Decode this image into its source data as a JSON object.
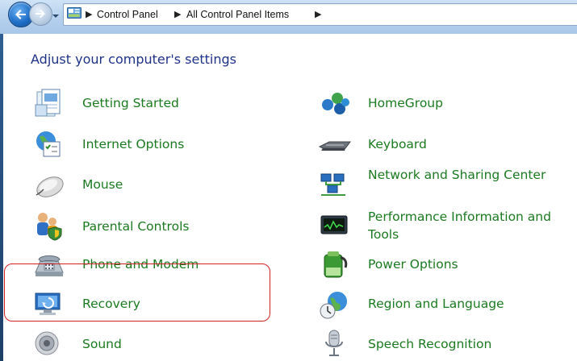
{
  "breadcrumbs": [
    "Control Panel",
    "All Control Panel Items"
  ],
  "heading": "Adjust your computer's settings",
  "items_left": [
    {
      "label": "Getting Started",
      "icon": "getting-started-icon"
    },
    {
      "label": "Internet Options",
      "icon": "internet-options-icon"
    },
    {
      "label": "Mouse",
      "icon": "mouse-icon"
    },
    {
      "label": "Parental Controls",
      "icon": "parental-controls-icon"
    },
    {
      "label": "Phone and Modem",
      "icon": "phone-modem-icon"
    },
    {
      "label": "Recovery",
      "icon": "recovery-icon"
    },
    {
      "label": "Sound",
      "icon": "sound-icon"
    }
  ],
  "items_right": [
    {
      "label": "HomeGroup",
      "icon": "homegroup-icon"
    },
    {
      "label": "Keyboard",
      "icon": "keyboard-icon"
    },
    {
      "label": "Network and Sharing Center",
      "icon": "network-sharing-icon"
    },
    {
      "label": "Performance Information and Tools",
      "icon": "performance-icon"
    },
    {
      "label": "Power Options",
      "icon": "power-options-icon"
    },
    {
      "label": "Region and Language",
      "icon": "region-language-icon"
    },
    {
      "label": "Speech Recognition",
      "icon": "speech-recognition-icon"
    }
  ],
  "colors": {
    "link": "#1a7a1f",
    "heading": "#1e3287",
    "highlight": "#d21f1f"
  }
}
